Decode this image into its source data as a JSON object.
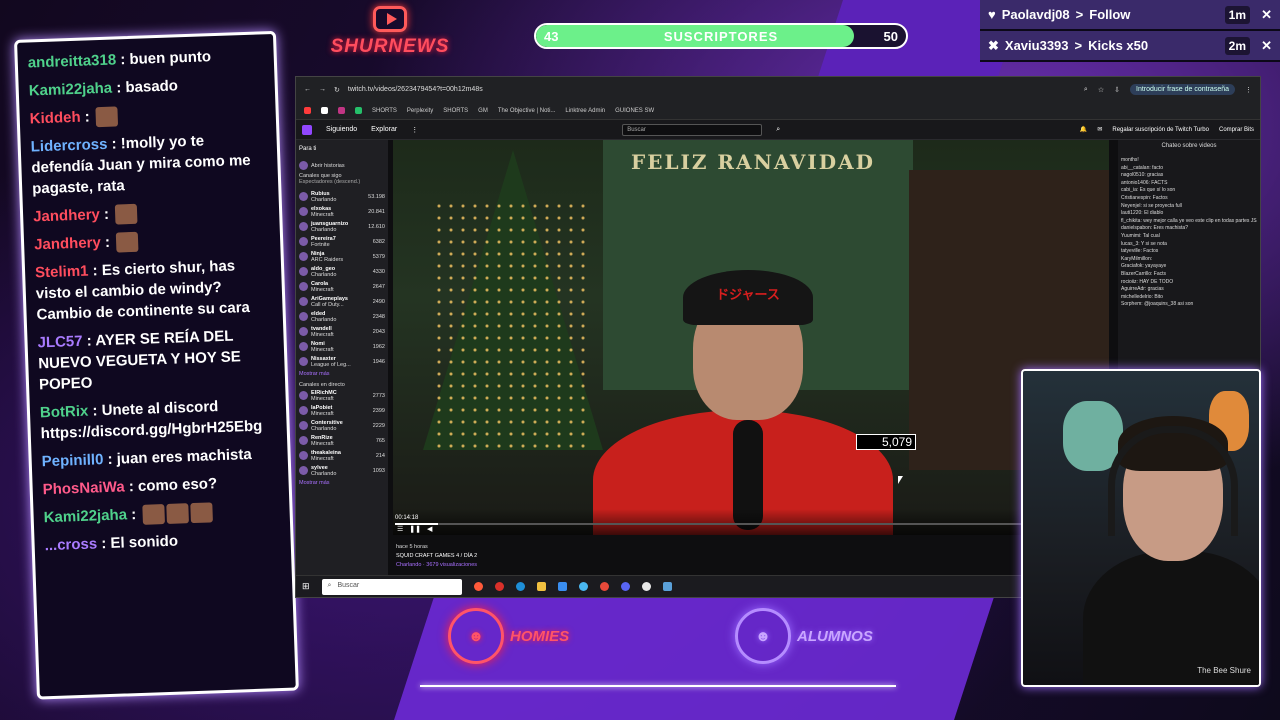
{
  "overlay": {
    "logo_text": "SHURNEWS",
    "subs": {
      "label": "SUSCRIPTORES",
      "current": "43",
      "goal": "50",
      "progress": 0.86
    },
    "alerts": [
      {
        "user": "Paolavdj08",
        "action": "Follow",
        "time": "1m",
        "icon": "heart-icon"
      },
      {
        "user": "Xaviu3393",
        "action": "Kicks x50",
        "time": "2m",
        "icon": "kick-icon"
      }
    ],
    "labels": {
      "homies": "HOMIES",
      "alumnos": "ALUMNOS"
    }
  },
  "chat": [
    {
      "user": "andreitta318",
      "color": "#4fd18b",
      "text": " : buen punto",
      "emotes": 0
    },
    {
      "user": "Kami22jaha",
      "color": "#4fd18b",
      "text": " : basado",
      "emotes": 0
    },
    {
      "user": "Kiddeh",
      "color": "#ff4d5e",
      "text": " : ",
      "emotes": 1
    },
    {
      "user": "Lidercross",
      "color": "#6fb2ff",
      "text": " : !molly yo te defendía Juan y mira como me pagaste, rata",
      "emotes": 0
    },
    {
      "user": "Jandhery",
      "color": "#ff4d5e",
      "text": " : ",
      "emotes": 1
    },
    {
      "user": "Jandhery",
      "color": "#ff4d5e",
      "text": " : ",
      "emotes": 1
    },
    {
      "user": "Stelim1",
      "color": "#ff4d5e",
      "text": " : Es cierto shur, has visto el cambio de windy? Cambio de continente su cara",
      "emotes": 0
    },
    {
      "user": "JLC57",
      "color": "#a97bff",
      "text": " : AYER SE REÍA DEL NUEVO VEGUETA Y HOY SE POPEO",
      "emotes": 0
    },
    {
      "user": "BotRix",
      "color": "#4fd18b",
      "text": " : Unete al discord https://discord.gg/HgbrH25Ebg",
      "emotes": 0
    },
    {
      "user": "Pepinill0",
      "color": "#6fb2ff",
      "text": " : juan eres machista",
      "emotes": 0
    },
    {
      "user": "PhosNaiWa",
      "color": "#ff5a8a",
      "text": " : como eso?",
      "emotes": 0
    },
    {
      "user": "Kami22jaha",
      "color": "#4fd18b",
      "text": " : ",
      "emotes": 3
    },
    {
      "user": "...cross",
      "color": "#a97bff",
      "text": " : El sonido",
      "emotes": 0
    }
  ],
  "browser": {
    "url": "twitch.tv/videos/2623479454?t=00h12m48s",
    "password_btn": "Introducir frase de contraseña",
    "bookmarks": [
      "SHORTS",
      "Perplexity",
      "SHORTS",
      "GM",
      "The Objective | Noti...",
      "Linktree Admin",
      "GUIONES SW"
    ],
    "nav": {
      "following": "Siguiendo",
      "browse": "Explorar",
      "search_placeholder": "Buscar",
      "turbo": "Regalar suscripción de Twitch Turbo",
      "bits": "Comprar Bits"
    },
    "sidebar": {
      "for_you": "Para ti",
      "open_stories": "Abrir historias",
      "followed_header": "Canales que sigo",
      "sort_label": "Espectadores (descend.)",
      "channels": [
        {
          "name": "Rubius",
          "game": "Charlando",
          "viewers": "53.198"
        },
        {
          "name": "elxokas",
          "game": "Minecraft",
          "viewers": "20.841"
        },
        {
          "name": "juansguarnizo",
          "game": "Charlando",
          "viewers": "12.610"
        },
        {
          "name": "Peereira7",
          "game": "Fortnite",
          "viewers": "6382"
        },
        {
          "name": "Ninja",
          "game": "ARC Raiders",
          "viewers": "5379"
        },
        {
          "name": "aldo_geo",
          "game": "Charlando",
          "viewers": "4330"
        },
        {
          "name": "Carola",
          "game": "Minecraft",
          "viewers": "2647"
        },
        {
          "name": "AriGameplays",
          "game": "Call of Duty...",
          "viewers": "2490"
        },
        {
          "name": "elded",
          "game": "Charlando",
          "viewers": "2348"
        },
        {
          "name": "tvandell",
          "game": "Minecraft",
          "viewers": "2043"
        },
        {
          "name": "Nomi",
          "game": "Minecraft",
          "viewers": "1962"
        },
        {
          "name": "Nissaxter",
          "game": "League of Leg...",
          "viewers": "1946"
        }
      ],
      "show_more": "Mostrar más",
      "live_header": "Canales en directo",
      "live": [
        {
          "name": "ElRichMC",
          "game": "Minecraft",
          "viewers": "2773"
        },
        {
          "name": "laPobiet",
          "game": "Minecraft",
          "viewers": "2399"
        },
        {
          "name": "Contersitive",
          "game": "Charlando",
          "viewers": "2229"
        },
        {
          "name": "RenRize",
          "game": "Minecraft",
          "viewers": "765"
        },
        {
          "name": "theakaleina",
          "game": "Minecraft",
          "viewers": "214"
        },
        {
          "name": "sylvee",
          "game": "Charlando",
          "viewers": "1093"
        }
      ],
      "show_more2": "Mostrar más"
    },
    "video": {
      "banner": "FELIZ RANAVIDAD",
      "cap_text": "ドジャース",
      "elapsed": "00:14:18",
      "progress": 0.06,
      "ago": "hace 5 horas",
      "title": "SQUID CRAFT GAMES 4 / DÍA 2",
      "meta": "Charlando · 3679 visualizaciones"
    },
    "video_chat": {
      "header": "Chateo sobre videos",
      "lines": [
        "months!",
        "abi__catalan: facto",
        "nagol0510: gracias",
        "antonio1406: FACTS",
        "cabi_ia: Es que sí lo son",
        "Cristianespin: Factos",
        "Neyenjel: si se proyecta full",
        "lauti1220: El diablo",
        "fl_chikita: wey mejor calla ye veo este clip en todas partes JSJSJS",
        "danielspabon: Eres machista?",
        "Yuumimi: Tal cual",
        "lucas_3: Y si se nota",
        "tatyeville: Factos",
        "KaryMilmillon:",
        "Graciafok: yayayaye",
        "BlazerCarrillo: Facts",
        "rocioiiz: HAY DE TODO",
        "AguirreAdr: gracias",
        "michelledelrio: Bito",
        "Sorphem: @joaquins_38 asi son"
      ]
    },
    "taskbar_search": "Buscar"
  },
  "viewer_count": "5,079",
  "cam_watermark": "The Bee Shure"
}
